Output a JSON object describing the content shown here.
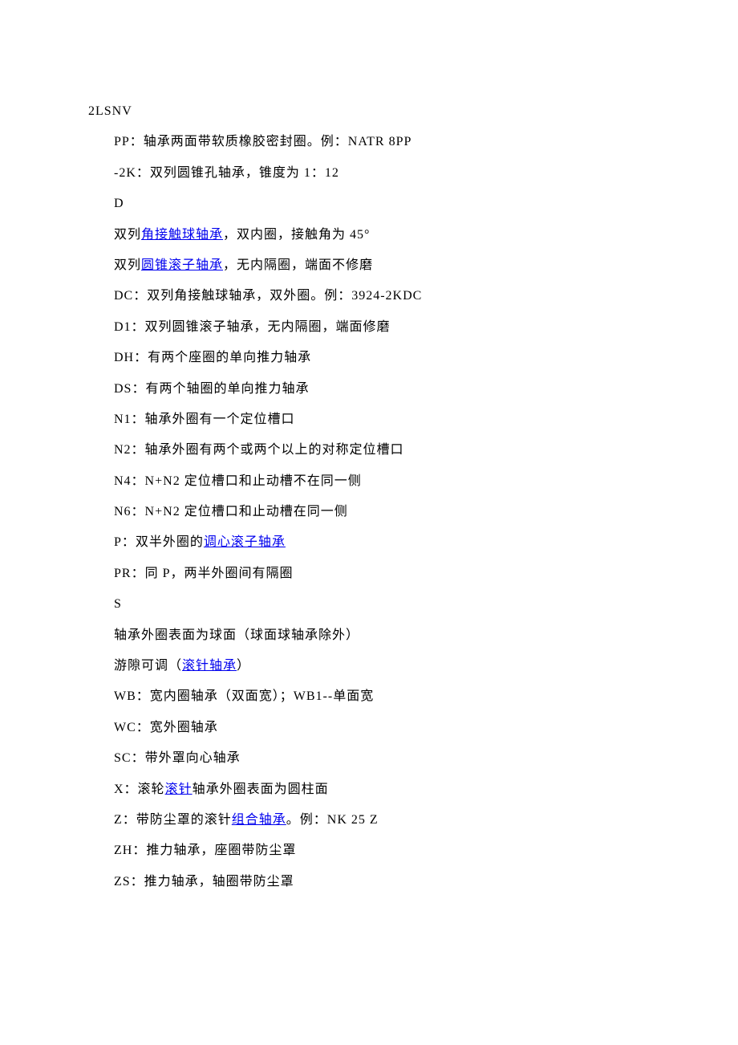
{
  "lines": [
    {
      "indent": false,
      "segs": [
        {
          "t": "2LSNV"
        }
      ]
    },
    {
      "indent": true,
      "segs": [
        {
          "t": "PP：轴承两面带软质橡胶密封圈。例：NATR 8PP"
        }
      ]
    },
    {
      "indent": true,
      "segs": [
        {
          "t": "-2K：双列圆锥孔轴承，锥度为 1：12"
        }
      ]
    },
    {
      "indent": true,
      "segs": [
        {
          "t": "D"
        }
      ]
    },
    {
      "indent": true,
      "segs": [
        {
          "t": "双列"
        },
        {
          "t": "角接触球轴承",
          "link": true
        },
        {
          "t": "，双内圈，接触角为 45°"
        }
      ]
    },
    {
      "indent": true,
      "segs": [
        {
          "t": "双列"
        },
        {
          "t": "圆锥滚子轴承",
          "link": true
        },
        {
          "t": "，无内隔圈，端面不修磨"
        }
      ]
    },
    {
      "indent": true,
      "segs": [
        {
          "t": "DC：双列角接触球轴承，双外圈。例：3924-2KDC"
        }
      ]
    },
    {
      "indent": true,
      "segs": [
        {
          "t": "D1：双列圆锥滚子轴承，无内隔圈，端面修磨"
        }
      ]
    },
    {
      "indent": true,
      "segs": [
        {
          "t": "DH：有两个座圈的单向推力轴承"
        }
      ]
    },
    {
      "indent": true,
      "segs": [
        {
          "t": "DS：有两个轴圈的单向推力轴承"
        }
      ]
    },
    {
      "indent": true,
      "segs": [
        {
          "t": "N1：轴承外圈有一个定位槽口"
        }
      ]
    },
    {
      "indent": true,
      "segs": [
        {
          "t": "N2：轴承外圈有两个或两个以上的对称定位槽口"
        }
      ]
    },
    {
      "indent": true,
      "segs": [
        {
          "t": "N4：N+N2 定位槽口和止动槽不在同一侧"
        }
      ]
    },
    {
      "indent": true,
      "segs": [
        {
          "t": "N6：N+N2 定位槽口和止动槽在同一侧"
        }
      ]
    },
    {
      "indent": true,
      "segs": [
        {
          "t": "P：双半外圈的"
        },
        {
          "t": "调心滚子轴承",
          "link": true
        }
      ]
    },
    {
      "indent": true,
      "segs": [
        {
          "t": "PR：同 P，两半外圈间有隔圈"
        }
      ]
    },
    {
      "indent": true,
      "segs": [
        {
          "t": "S"
        }
      ]
    },
    {
      "indent": true,
      "segs": [
        {
          "t": "轴承外圈表面为球面（球面球轴承除外）"
        }
      ]
    },
    {
      "indent": true,
      "segs": [
        {
          "t": "游隙可调（"
        },
        {
          "t": "滚针轴承",
          "link": true
        },
        {
          "t": "）"
        }
      ]
    },
    {
      "indent": true,
      "segs": [
        {
          "t": "WB：宽内圈轴承（双面宽）；WB1--单面宽"
        }
      ]
    },
    {
      "indent": true,
      "segs": [
        {
          "t": "WC：宽外圈轴承"
        }
      ]
    },
    {
      "indent": true,
      "segs": [
        {
          "t": "SC：带外罩向心轴承"
        }
      ]
    },
    {
      "indent": true,
      "segs": [
        {
          "t": "X：滚轮"
        },
        {
          "t": "滚针",
          "link": true
        },
        {
          "t": "轴承外圈表面为圆柱面"
        }
      ]
    },
    {
      "indent": true,
      "segs": [
        {
          "t": "Z：带防尘罩的滚针"
        },
        {
          "t": "组合轴承",
          "link": true
        },
        {
          "t": "。例：NK 25 Z"
        }
      ]
    },
    {
      "indent": true,
      "segs": [
        {
          "t": "ZH：推力轴承，座圈带防尘罩"
        }
      ]
    },
    {
      "indent": true,
      "segs": [
        {
          "t": "ZS：推力轴承，轴圈带防尘罩"
        }
      ]
    }
  ]
}
